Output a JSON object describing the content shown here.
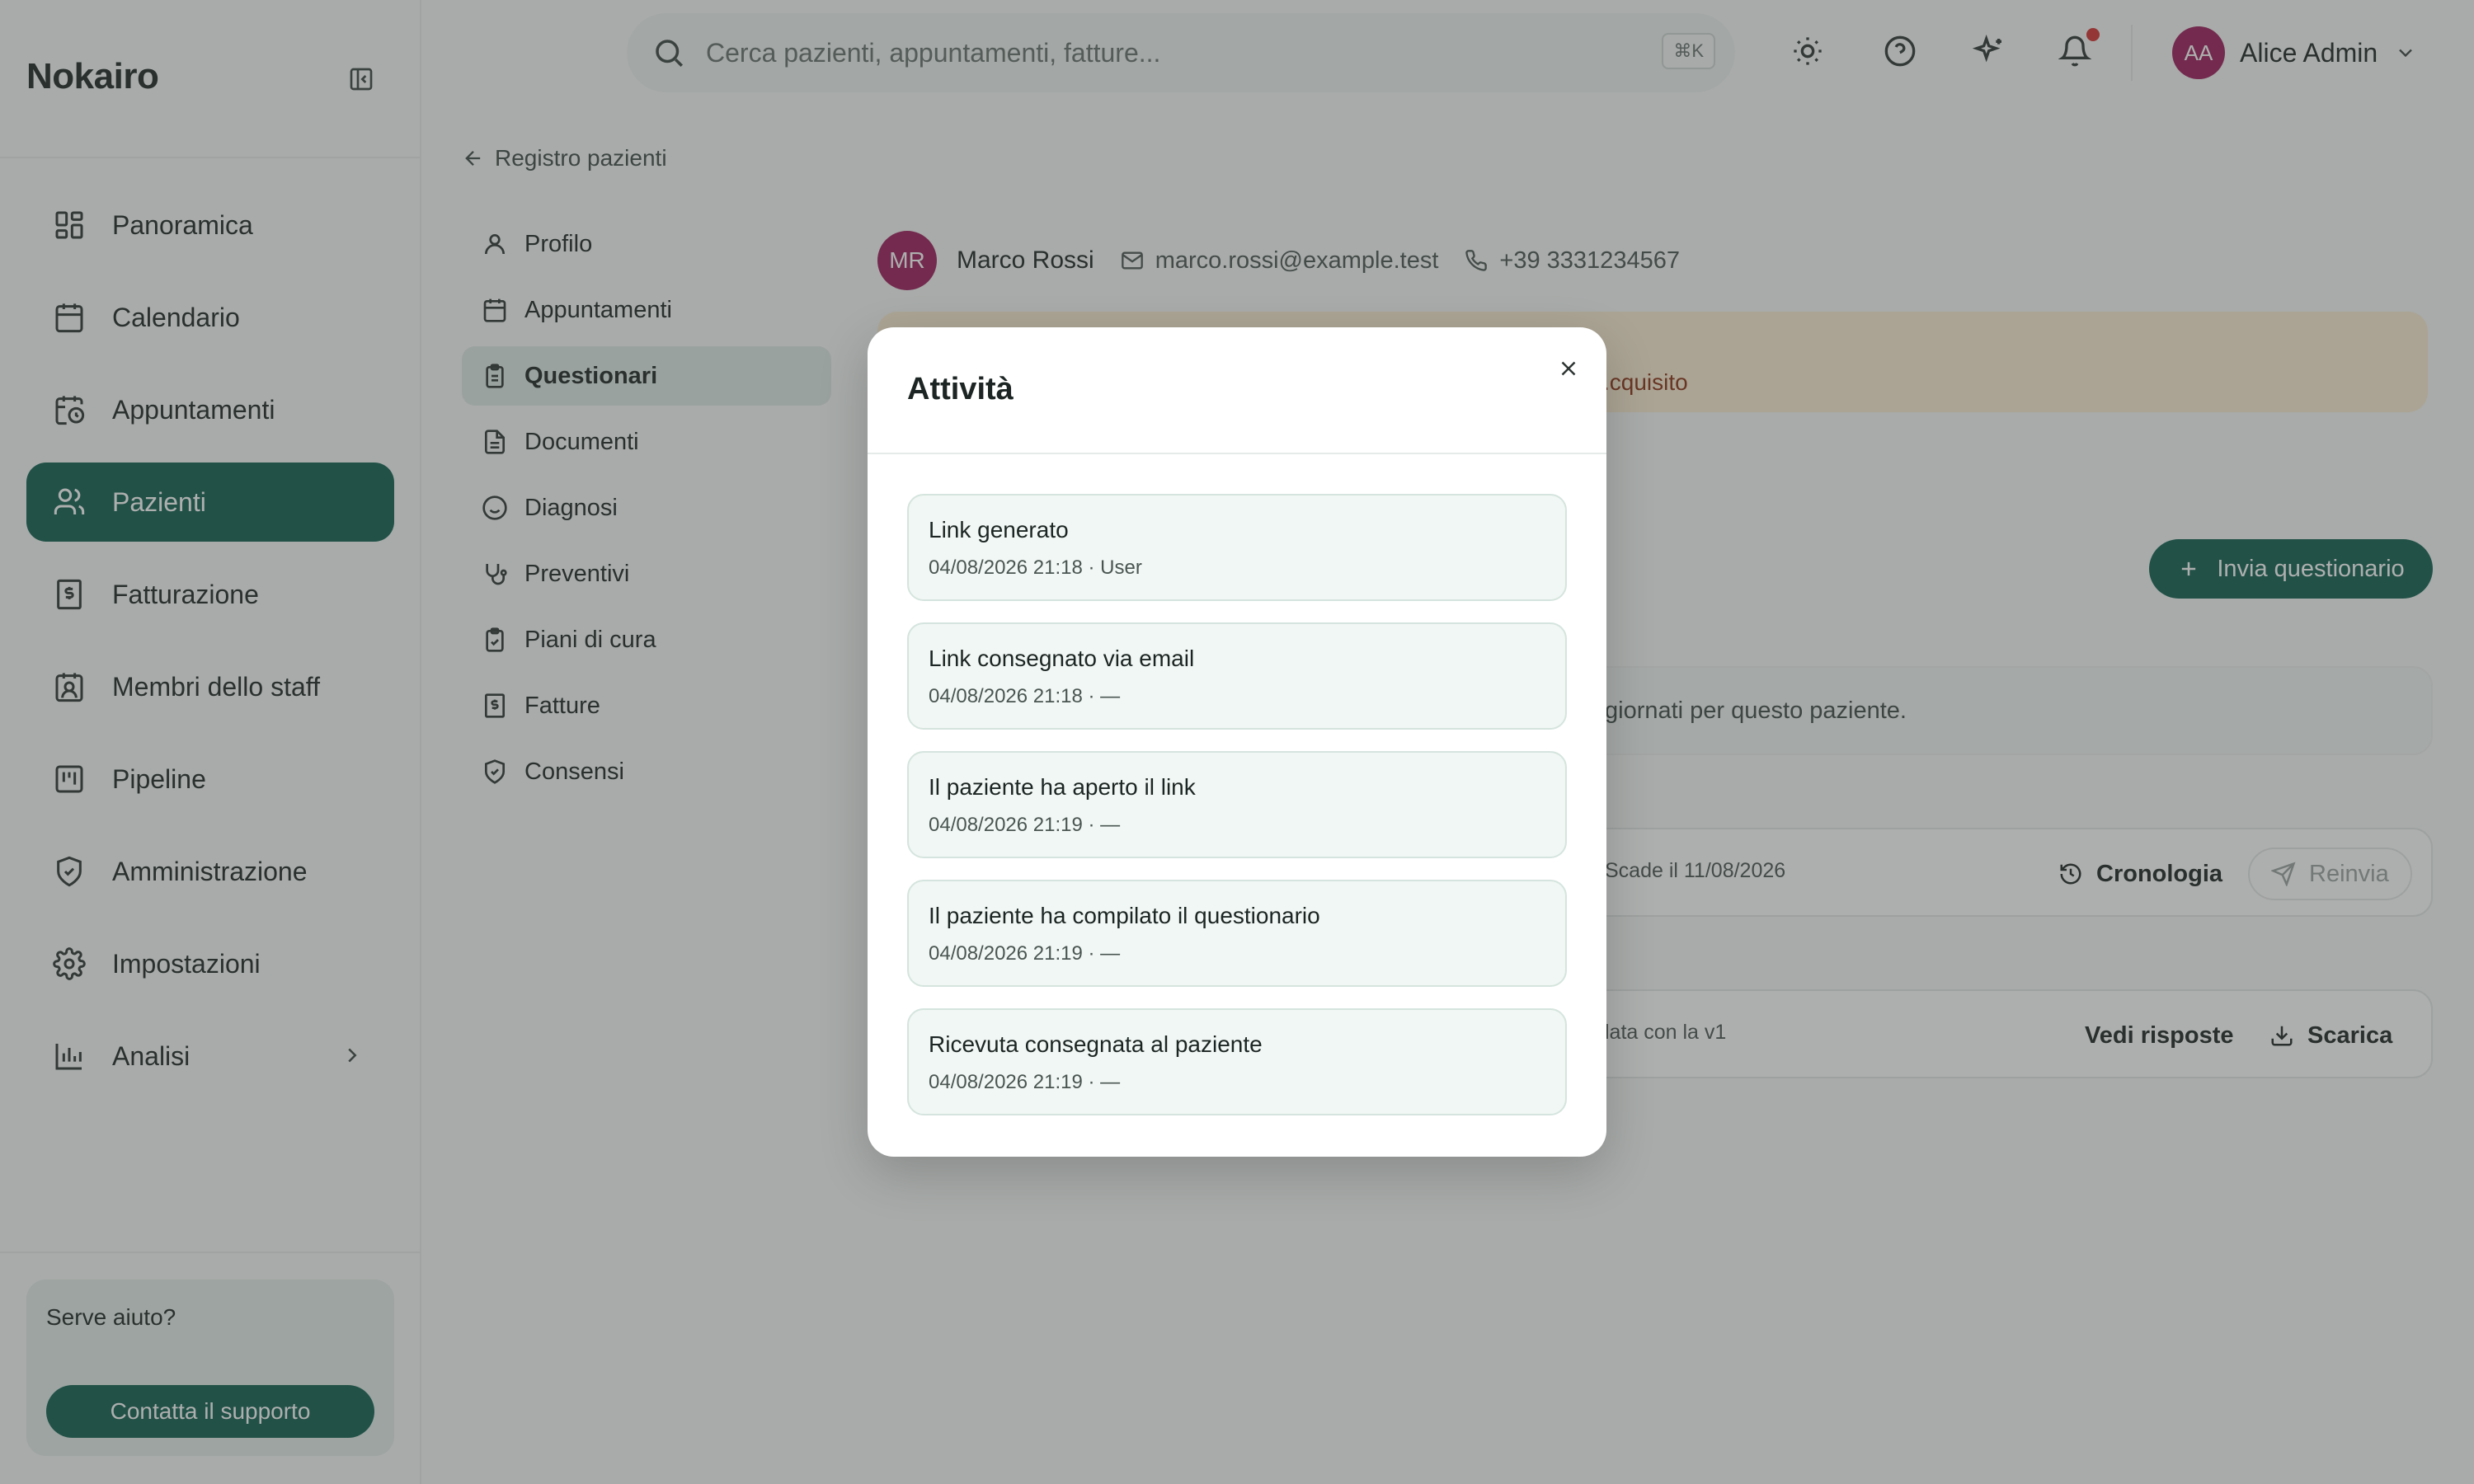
{
  "sidebar": {
    "brand": "Nokairo",
    "items": [
      {
        "label": "Panoramica",
        "icon": "dashboard-icon"
      },
      {
        "label": "Calendario",
        "icon": "calendar-icon"
      },
      {
        "label": "Appuntamenti",
        "icon": "calendar-clock-icon"
      },
      {
        "label": "Pazienti",
        "icon": "users-icon",
        "active": true
      },
      {
        "label": "Fatturazione",
        "icon": "receipt-icon"
      },
      {
        "label": "Membri dello staff",
        "icon": "id-badge-icon"
      },
      {
        "label": "Pipeline",
        "icon": "kanban-icon"
      },
      {
        "label": "Amministrazione",
        "icon": "shield-check-icon"
      },
      {
        "label": "Impostazioni",
        "icon": "gear-icon"
      },
      {
        "label": "Analisi",
        "icon": "bar-chart-icon"
      }
    ],
    "help": {
      "title": "Serve aiuto?",
      "button": "Contatta il supporto"
    }
  },
  "topbar": {
    "search_placeholder": "Cerca pazienti, appuntamenti, fatture...",
    "shortcut": "⌘K",
    "user": {
      "initials": "AA",
      "name": "Alice Admin"
    }
  },
  "page": {
    "back_label": "Registro pazienti",
    "subnav": [
      {
        "label": "Profilo",
        "icon": "user-icon"
      },
      {
        "label": "Appuntamenti",
        "icon": "calendar-icon"
      },
      {
        "label": "Questionari",
        "icon": "clipboard-icon",
        "active": true
      },
      {
        "label": "Documenti",
        "icon": "document-icon"
      },
      {
        "label": "Diagnosi",
        "icon": "smile-icon"
      },
      {
        "label": "Preventivi",
        "icon": "stethoscope-icon"
      },
      {
        "label": "Piani di cura",
        "icon": "clipboard-check-icon"
      },
      {
        "label": "Fatture",
        "icon": "receipt-icon"
      },
      {
        "label": "Consensi",
        "icon": "shield-check-icon"
      }
    ],
    "patient": {
      "initials": "MR",
      "name": "Marco Rossi",
      "email": "marco.rossi@example.test",
      "phone": "+39 3331234567"
    },
    "alert_text_visible": "cquisito.",
    "send_button": "Invia questionario",
    "info_text_visible": "giornati per questo paziente.",
    "questionnaire_meta": "Scade il 11/08/2026",
    "history_button": "Cronologia",
    "resend_button": "Reinvia",
    "response_meta": "lata con la v1",
    "view_responses_button": "Vedi risposte",
    "download_button": "Scarica"
  },
  "modal": {
    "title": "Attività",
    "events": [
      {
        "title": "Link generato",
        "meta": "04/08/2026 21:18 · User"
      },
      {
        "title": "Link consegnato via email",
        "meta": "04/08/2026 21:18 · —"
      },
      {
        "title": "Il paziente ha aperto il link",
        "meta": "04/08/2026 21:19 · —"
      },
      {
        "title": "Il paziente ha compilato il questionario",
        "meta": "04/08/2026 21:19 · —"
      },
      {
        "title": "Ricevuta consegnata al paziente",
        "meta": "04/08/2026 21:19 · —"
      }
    ]
  },
  "colors": {
    "accent": "#0f5e4f",
    "avatar": "#9b1b5a",
    "notification": "#d32f2f",
    "alert_bg": "#fbecd2"
  }
}
